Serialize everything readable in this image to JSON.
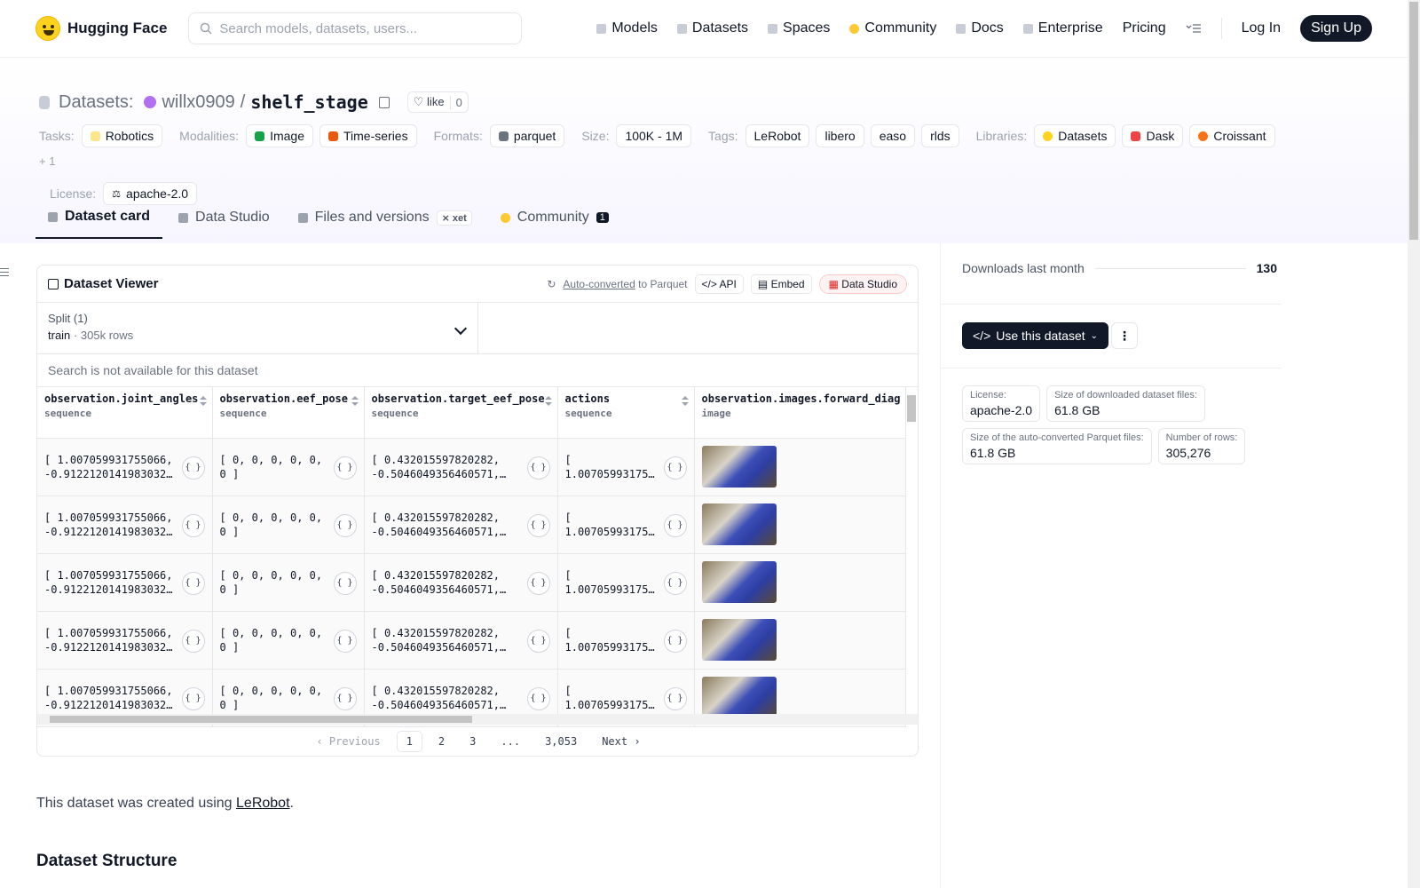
{
  "nav": {
    "brand": "Hugging Face",
    "search_placeholder": "Search models, datasets, users...",
    "links": [
      "Models",
      "Datasets",
      "Spaces",
      "Community",
      "Docs",
      "Enterprise",
      "Pricing"
    ],
    "login": "Log In",
    "signup": "Sign Up"
  },
  "header": {
    "section": "Datasets:",
    "org": "willx0909",
    "slash": "/",
    "name": "shelf_stage",
    "like_label": "like",
    "like_count": "0"
  },
  "tags": {
    "tasks_label": "Tasks:",
    "tasks": [
      "Robotics"
    ],
    "modalities_label": "Modalities:",
    "modalities": [
      "Image",
      "Time-series"
    ],
    "formats_label": "Formats:",
    "formats": [
      "parquet"
    ],
    "size_label": "Size:",
    "size": "100K - 1M",
    "tags_label": "Tags:",
    "tags": [
      "LeRobot",
      "libero",
      "easo",
      "rlds"
    ],
    "libraries_label": "Libraries:",
    "libraries": [
      "Datasets",
      "Dask",
      "Croissant"
    ],
    "libraries_more": "+ 1",
    "license_label": "License:",
    "license": "apache-2.0"
  },
  "tabs": {
    "card": "Dataset card",
    "studio": "Data Studio",
    "files": "Files and versions",
    "xet": "xet",
    "community": "Community",
    "community_count": "1"
  },
  "viewer": {
    "title": "Dataset Viewer",
    "auto": "Auto-converted",
    "to_parquet": "to Parquet",
    "api": "API",
    "embed": "Embed",
    "studio": "Data Studio",
    "split_label": "Split (1)",
    "split_value": "train",
    "split_dot": "·",
    "split_rows": "305k rows",
    "search_na": "Search is not available for this dataset",
    "columns": [
      {
        "name": "observation.joint_angles",
        "type": "sequence"
      },
      {
        "name": "observation.eef_pose",
        "type": "sequence"
      },
      {
        "name": "observation.target_eef_pose",
        "type": "sequence"
      },
      {
        "name": "actions",
        "type": "sequence"
      },
      {
        "name": "observation.images.forward_diag",
        "type": "image"
      }
    ],
    "rows": [
      [
        "[ 1.007059931755066,\n-0.9122120141983032,…",
        "[ 0, 0, 0, 0, 0,\n0 ]",
        "[ 0.432015597820282,\n-0.5046049356460571,…",
        "[\n1.00705993175…"
      ],
      [
        "[ 1.007059931755066,\n-0.9122120141983032,…",
        "[ 0, 0, 0, 0, 0,\n0 ]",
        "[ 0.432015597820282,\n-0.5046049356460571,…",
        "[\n1.00705993175…"
      ],
      [
        "[ 1.007059931755066,\n-0.9122120141983032,…",
        "[ 0, 0, 0, 0, 0,\n0 ]",
        "[ 0.432015597820282,\n-0.5046049356460571,…",
        "[\n1.00705993175…"
      ],
      [
        "[ 1.007059931755066,\n-0.9122120141983032,…",
        "[ 0, 0, 0, 0, 0,\n0 ]",
        "[ 0.432015597820282,\n-0.5046049356460571,…",
        "[\n1.00705993175…"
      ],
      [
        "[ 1.007059931755066,\n-0.9122120141983032,…",
        "[ 0, 0, 0, 0, 0,\n0 ]",
        "[ 0.432015597820282,\n-0.5046049356460571,…",
        "[\n1.00705993175…"
      ]
    ],
    "expand_glyph": "{ }",
    "pager": {
      "prev": "Previous",
      "pages": [
        "1",
        "2",
        "3",
        "...",
        "3,053"
      ],
      "next": "Next"
    }
  },
  "body": {
    "desc_prefix": "This dataset was created using ",
    "desc_link": "LeRobot",
    "desc_suffix": ".",
    "structure_heading": "Dataset Structure"
  },
  "sidebar": {
    "downloads_label": "Downloads last month",
    "downloads": "130",
    "use_button": "Use this dataset",
    "stats": [
      {
        "k": "License:",
        "v": "apache-2.0"
      },
      {
        "k": "Size of downloaded dataset files:",
        "v": "61.8 GB"
      },
      {
        "k": "Size of the auto-converted Parquet files:",
        "v": "61.8 GB"
      },
      {
        "k": "Number of rows:",
        "v": "305,276"
      }
    ]
  },
  "colors": {
    "brand_yellow": "#ffd21e",
    "dark": "#111827",
    "org": "#b070f0"
  }
}
